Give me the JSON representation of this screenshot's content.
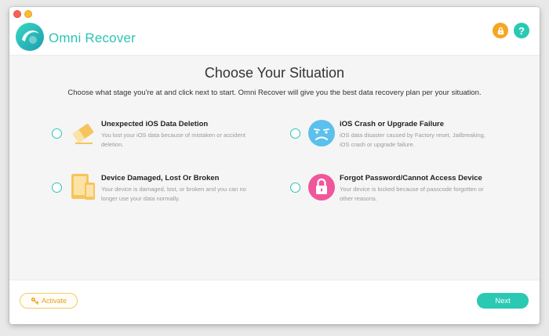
{
  "app": {
    "title": "Omni Recover"
  },
  "header": {
    "lock_icon": "lock-icon",
    "help_label": "?"
  },
  "main": {
    "heading": "Choose Your Situation",
    "subheading": "Choose what stage you're at and click next to start. Omni Recover will give you the best data recovery plan per your situation.",
    "options": [
      {
        "title": "Unexpected iOS Data Deletion",
        "desc": "You lost your iOS data because of mistaken or accident deletion.",
        "icon": "eraser-icon"
      },
      {
        "title": "iOS Crash or Upgrade Failure",
        "desc": "iOS data disaster caused by Factory reset, Jailbreaking, iOS crash or upgrade failure.",
        "icon": "sad-face-icon"
      },
      {
        "title": "Device Damaged, Lost Or Broken",
        "desc": "Your device is damaged, lost, or broken and you can no longer use your data normally.",
        "icon": "devices-icon"
      },
      {
        "title": "Forgot Password/Cannot Access Device",
        "desc": "Your device is locked because of passcode forgotten or other reasons.",
        "icon": "padlock-icon"
      }
    ]
  },
  "footer": {
    "activate_label": "Activate",
    "next_label": "Next"
  },
  "colors": {
    "accent": "#2bc9b4",
    "warning": "#f5a623",
    "eraser": "#f7c45c",
    "face": "#5bc0eb",
    "lock": "#f0569b"
  }
}
